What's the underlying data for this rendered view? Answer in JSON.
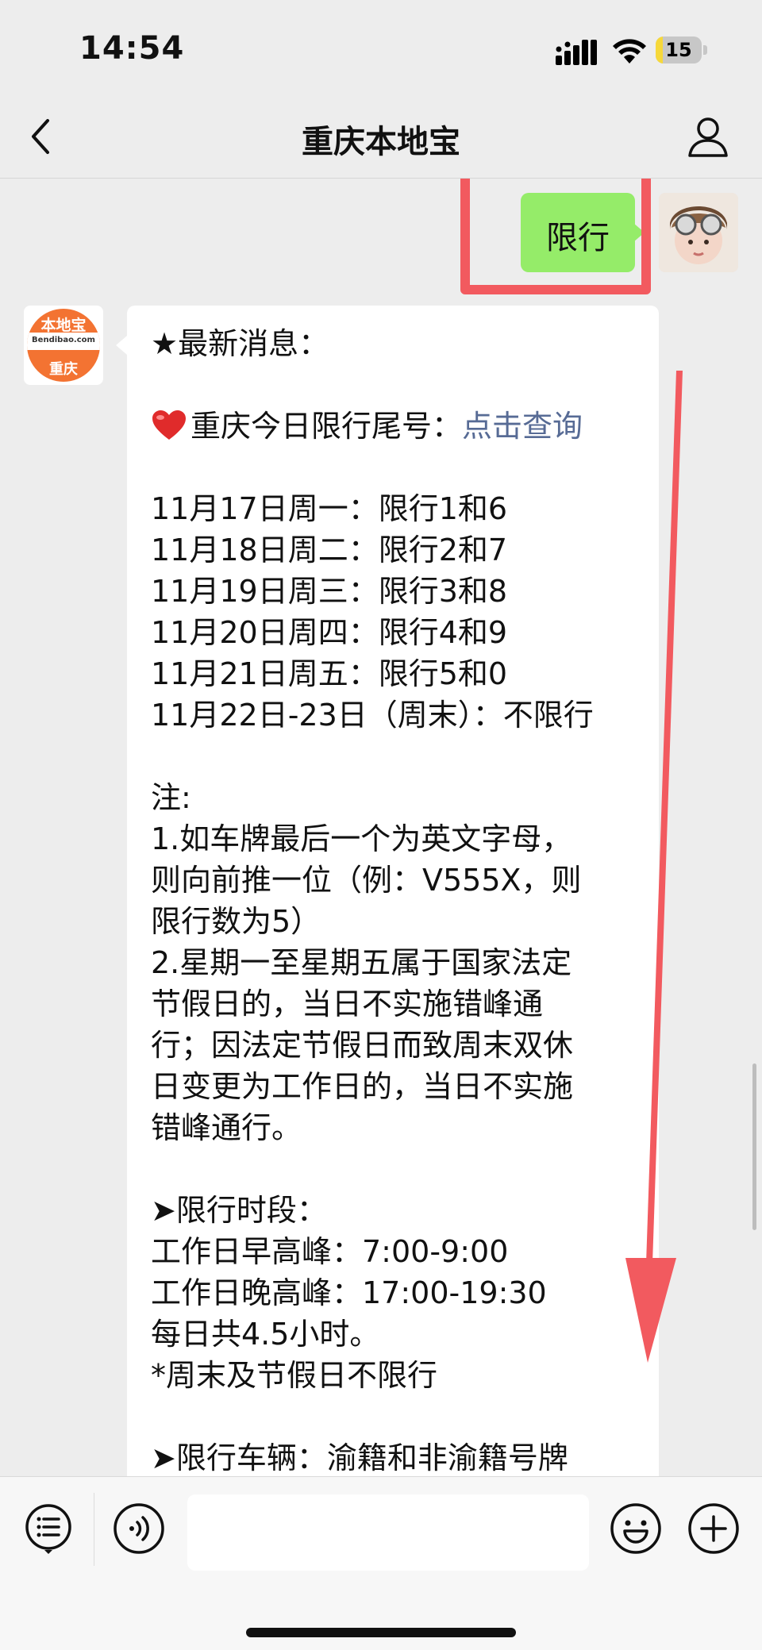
{
  "status_bar": {
    "time": "14:54",
    "battery_level": "15",
    "battery_fraction": 0.15,
    "icons": [
      "signal-icon",
      "wifi-icon",
      "battery-icon"
    ]
  },
  "nav": {
    "title": "重庆本地宝",
    "icons": [
      "back-icon",
      "user-profile-icon"
    ]
  },
  "messages": {
    "sent": {
      "text": "限行"
    },
    "bot_avatar": {
      "top": "本地宝",
      "mid": "Bendibao.com",
      "bottom": "重庆"
    },
    "received": {
      "header": "★最新消息：",
      "today_prefix": "重庆今日限行尾号：",
      "today_link": "点击查询",
      "schedule": [
        "11月17日周一：限行1和6",
        "11月18日周二：限行2和7",
        "11月19日周三：限行3和8",
        "11月20日周四：限行4和9",
        "11月21日周五：限行5和0",
        "11月22日-23日（周末）：不限行"
      ],
      "note_title": "注:",
      "notes": [
        "1.如车牌最后一个为英文字母，",
        "则向前推一位（例：V555X，则",
        "限行数为5）",
        "2.星期一至星期五属于国家法定",
        "节假日的，当日不实施错峰通",
        "行；因法定节假日而致周末双休",
        "日变更为工作日的，当日不实施",
        "错峰通行。"
      ],
      "period_title": "➤限行时段：",
      "periods": [
        "工作日早高峰：7:00-9:00",
        "工作日晚高峰：17:00-19:30",
        "每日共4.5小时。",
        "*周末及节假日不限行"
      ],
      "vehicles": "➤限行车辆：渝籍和非渝籍号牌"
    }
  },
  "annotation": {
    "color": "#f25a5f"
  },
  "input_bar": {
    "placeholder": "",
    "icons": [
      "menu-list-icon",
      "voice-icon",
      "emoji-icon",
      "plus-icon"
    ]
  },
  "colors": {
    "background": "#ededed",
    "sent_bubble": "#95ec69",
    "link": "#576b95"
  }
}
